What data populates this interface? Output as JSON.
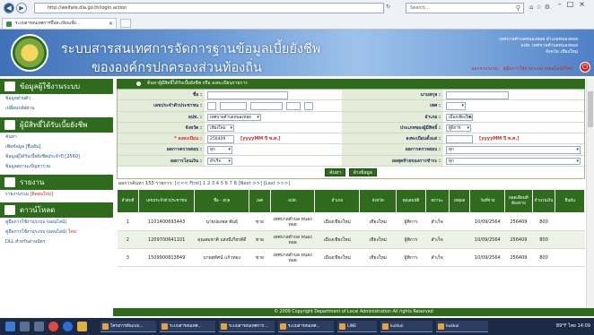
{
  "browser": {
    "url": "http://welfare.dla.go.th/login.action",
    "search_placeholder": "Search...",
    "tab_title": "ระบบสารสนเทศการขึ้นทะเบียนเบี้ย...",
    "tab_close": "×"
  },
  "header": {
    "title_line1": "ระบบสารสนเทศการจัดการฐานข้อมูลเบี้ยยังชีพ",
    "title_line2": "ขององค์กรปกครองส่วนท้องถิ่น",
    "org_line1": "เทศบาลตำบลหนองหอย อำเภอหนองหอย",
    "org_line2": "อปท. เทศบาลตำบลหนองหอย",
    "org_line3": "จังหวัด เชียงใหม่",
    "link_logout": "ออกจากระบบ",
    "link_manual": "คู่มือการใช้งานระบบ (ออนไลน์)ใหม่"
  },
  "sidebar": {
    "sections": [
      {
        "title": "ข้อมูลผู้ใช้งานระบบ",
        "items": [
          {
            "label": "ข้อมูลส่วนตัว",
            "red": false
          },
          {
            "label": "เปลี่ยนรหัสผ่าน",
            "red": false
          }
        ]
      },
      {
        "title": "ผู้มีสิทธิ์ได้รับเบี้ยยังชีพ",
        "items": [
          {
            "label": "ค้นหา",
            "red": false
          },
          {
            "label": "เพิ่มข้อมูล [ยืนยัน]",
            "red": false
          },
          {
            "label": "ข้อมูลผู้ได้รับเบี้ยยังชีพประจำปี [2560]",
            "red": false
          },
          {
            "label": "ข้อมูลสถานะปัญหาร่วม",
            "red": false
          }
        ]
      },
      {
        "title": "รายงาน",
        "items": [
          {
            "label": "รายงานรวม",
            "red": false,
            "tag": "[ติดต่อใหม่]"
          }
        ]
      },
      {
        "title": "ดาวน์โหลด",
        "items": [
          {
            "label": "คู่มือการใช้งานระบบ (ออนไลน์)",
            "red": false
          },
          {
            "label": "คู่มือการใช้งานระบบ (ออนไลน์)",
            "red": false,
            "tag": "ใหม่"
          },
          {
            "label": "DLL สำหรับอ่านบัตร",
            "red": false
          }
        ]
      }
    ]
  },
  "form": {
    "title": "ค้นหาผู้มีสิทธิ์ได้รับเบี้ยยังชีพ หรือ ลงทะเบียนรายการ",
    "labels": {
      "name": "ชื่อ :",
      "surname": "นามสกุล :",
      "citizen_id": "เลขประจำตัวประชาชน :",
      "gender": "เพศ :",
      "org": "อปท. :",
      "district": "อำเภอ :",
      "province": "จังหวัด :",
      "person_type": "ประเภทของผู้มีสิทธิ์ :",
      "reg_date": "* ลงทะเบียน :",
      "start_date": "ลงทะเบียนตั้งแต่ :",
      "status": "ผลการตรวจสอบ :",
      "status2": "ผลการตรวจสอบ :",
      "payment": "ผลการโอนเงิน :",
      "pay_type": "ผลสุดท้ายของการชำระ :"
    },
    "values": {
      "org": "เทศบาลตำบลหนองหอย",
      "district": "เมืองเชียงใหม่",
      "province": "เชียงใหม่",
      "person_type": "ผู้พิการ",
      "reg_date": "256409",
      "date_hint": "[yyyyMM ปี พ.ศ.]",
      "status": "ทุก",
      "status2": "ทุก",
      "payment": "สำเร็จ",
      "pay_type": "ทุก"
    },
    "buttons": {
      "search": "ค้นหา",
      "clear": "ล้างข้อมูล"
    }
  },
  "pager": {
    "summary": "ผลการค้นหา 155 รายการ:",
    "first": "[<<< First]",
    "pages": [
      "1",
      "2",
      "3",
      "4",
      "5",
      "6",
      "7",
      "8"
    ],
    "next": "[Next >>]",
    "last": "[Last >>>]"
  },
  "table": {
    "headers": [
      "ลำดับที่",
      "เลขประจำตัวประชาชน",
      "ชื่อ - สกุล",
      "เพศ",
      "อปท.",
      "อำเภอ",
      "จังหวัด",
      "คุณสมบัติ",
      "สถานะ",
      "เหตุผล",
      "วันที่จ่าย",
      "ยอดเดือนที่ต้องจ่าย",
      "จำนวนเงิน",
      "ยืนยัน"
    ],
    "rows": [
      [
        "1",
        "1101400693443",
        "นายปองพล พันธุ์",
        "ชาย",
        "เทศบาลตำบล หนองหอย",
        "เมืองเชียงใหม่",
        "เชียงใหม่",
        "ผู้พิการ",
        "สำเร็จ",
        "",
        "10/09/2564",
        "256409",
        "800",
        ""
      ],
      [
        "2",
        "1209700641101",
        "คุณสมชาติ แสงมีเกียรติดี",
        "ชาย",
        "เทศบาลตำบล หนองหอย",
        "เมืองเชียงใหม่",
        "เชียงใหม่",
        "ผู้พิการ",
        "สำเร็จ",
        "",
        "10/09/2564",
        "256409",
        "800",
        ""
      ],
      [
        "3",
        "1509900813849",
        "นายสุทัศน์ แก้วทอง",
        "ชาย",
        "เทศบาลตำบล หนองหอย",
        "เมืองเชียงใหม่",
        "เชียงใหม่",
        "ผู้พิการ",
        "สำเร็จ",
        "",
        "10/09/2564",
        "256409",
        "800",
        ""
      ]
    ]
  },
  "footer": "© 2009 Copyright Department of Local Administration All rights Reserved",
  "taskbar": {
    "items": [
      "โครงการต้นแบบ...",
      "ระบบสารสนเทศ...",
      "ระบบสารสนเทศการ...",
      "ระบบสารสนเทศ...",
      "LINE",
      "kukkai",
      "kukkai"
    ],
    "weather": "89°F",
    "lang": "ไทย",
    "time": "14:09"
  },
  "colors": {
    "green": "#2e6b1d",
    "banner": "#5b8fd0",
    "red": "#d32f2f"
  }
}
